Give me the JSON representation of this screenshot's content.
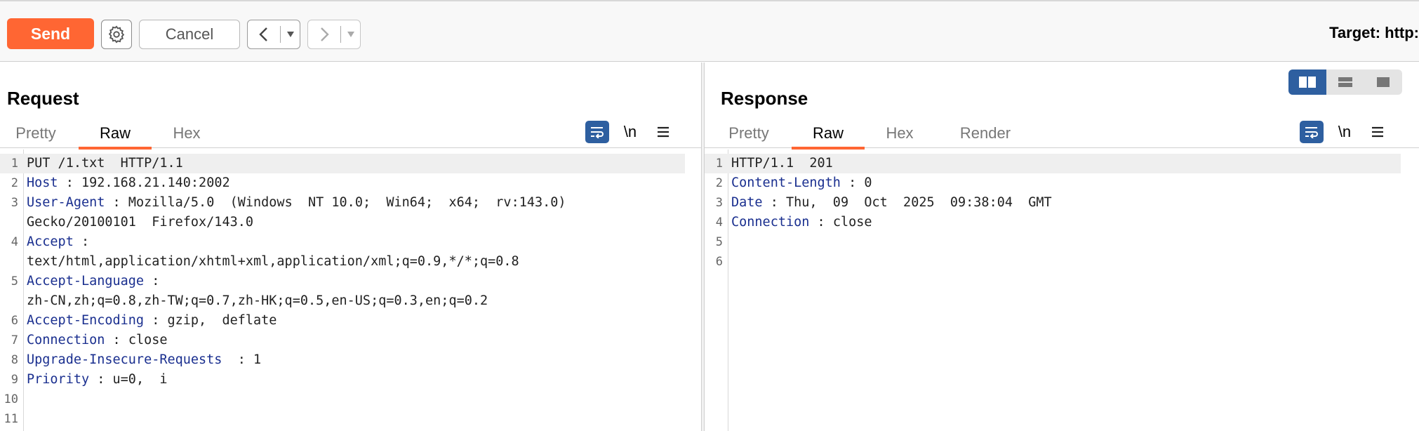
{
  "toolbar": {
    "send_label": "Send",
    "settings_icon": "gear-icon",
    "cancel_label": "Cancel",
    "back_icon": "chevron-left-icon",
    "forward_icon": "chevron-right-icon",
    "dropdown_icon": "caret-down-icon",
    "target_label": "Target: http:"
  },
  "colors": {
    "accent": "#ff6633",
    "toggle_active": "#2e5fa0",
    "header_key": "#1a2f8f"
  },
  "request": {
    "title": "Request",
    "tabs": [
      {
        "label": "Pretty",
        "active": false
      },
      {
        "label": "Raw",
        "active": true
      },
      {
        "label": "Hex",
        "active": false
      }
    ],
    "newline_label": "\\n",
    "lines": [
      {
        "n": "1",
        "key": "",
        "sep": "",
        "value": "PUT /1.txt  HTTP/1.1",
        "highlight": true
      },
      {
        "n": "2",
        "key": "Host",
        "sep": " : ",
        "value": "192.168.21.140:2002"
      },
      {
        "n": "3",
        "key": "User-Agent",
        "sep": " : ",
        "value": "Mozilla/5.0  (Windows  NT 10.0;  Win64;  x64;  rv:143.0)"
      },
      {
        "n": "",
        "key": "",
        "sep": "",
        "value": "Gecko/20100101  Firefox/143.0"
      },
      {
        "n": "4",
        "key": "Accept",
        "sep": " :",
        "value": ""
      },
      {
        "n": "",
        "key": "",
        "sep": "",
        "value": "text/html,application/xhtml+xml,application/xml;q=0.9,*/*;q=0.8"
      },
      {
        "n": "5",
        "key": "Accept-Language",
        "sep": " :",
        "value": ""
      },
      {
        "n": "",
        "key": "",
        "sep": "",
        "value": "zh-CN,zh;q=0.8,zh-TW;q=0.7,zh-HK;q=0.5,en-US;q=0.3,en;q=0.2"
      },
      {
        "n": "6",
        "key": "Accept-Encoding",
        "sep": " : ",
        "value": "gzip,  deflate"
      },
      {
        "n": "7",
        "key": "Connection",
        "sep": " : ",
        "value": "close"
      },
      {
        "n": "8",
        "key": "Upgrade-Insecure-Requests",
        "sep": "  : ",
        "value": "1"
      },
      {
        "n": "9",
        "key": "Priority",
        "sep": " : ",
        "value": "u=0,  i"
      },
      {
        "n": "10",
        "key": "",
        "sep": "",
        "value": ""
      },
      {
        "n": "11",
        "key": "",
        "sep": "",
        "value": ""
      }
    ]
  },
  "response": {
    "title": "Response",
    "tabs": [
      {
        "label": "Pretty",
        "active": false
      },
      {
        "label": "Raw",
        "active": true
      },
      {
        "label": "Hex",
        "active": false
      },
      {
        "label": "Render",
        "active": false
      }
    ],
    "newline_label": "\\n",
    "layout_modes": [
      {
        "icon": "split-horizontal-icon",
        "active": true
      },
      {
        "icon": "split-vertical-icon",
        "active": false
      },
      {
        "icon": "single-pane-icon",
        "active": false
      }
    ],
    "lines": [
      {
        "n": "1",
        "key": "",
        "sep": "",
        "value": "HTTP/1.1  201",
        "highlight": true
      },
      {
        "n": "2",
        "key": "Content-Length",
        "sep": " : ",
        "value": "0"
      },
      {
        "n": "3",
        "key": "Date",
        "sep": " : ",
        "value": "Thu,  09  Oct  2025  09:38:04  GMT"
      },
      {
        "n": "4",
        "key": "Connection",
        "sep": " : ",
        "value": "close"
      },
      {
        "n": "5",
        "key": "",
        "sep": "",
        "value": ""
      },
      {
        "n": "6",
        "key": "",
        "sep": "",
        "value": ""
      }
    ]
  }
}
